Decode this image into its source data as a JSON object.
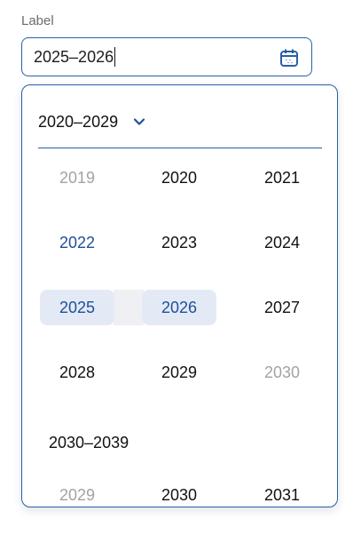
{
  "field": {
    "label": "Label",
    "value": "2025–2026",
    "calendar_icon": "calendar-icon"
  },
  "picker": {
    "header_label": "2020–2029",
    "header_icon": "chevron-down-icon",
    "years": [
      {
        "label": "2019",
        "state": "outside"
      },
      {
        "label": "2020",
        "state": "normal"
      },
      {
        "label": "2021",
        "state": "normal"
      },
      {
        "label": "2022",
        "state": "current"
      },
      {
        "label": "2023",
        "state": "normal"
      },
      {
        "label": "2024",
        "state": "normal"
      },
      {
        "label": "2025",
        "state": "range-start"
      },
      {
        "label": "2026",
        "state": "range-end"
      },
      {
        "label": "2027",
        "state": "normal"
      },
      {
        "label": "2028",
        "state": "normal"
      },
      {
        "label": "2029",
        "state": "normal"
      },
      {
        "label": "2030",
        "state": "outside"
      }
    ],
    "next_decade_label": "2030–2039",
    "next_years": [
      {
        "label": "2029",
        "state": "outside"
      },
      {
        "label": "2030",
        "state": "normal"
      },
      {
        "label": "2031",
        "state": "normal"
      }
    ]
  },
  "colors": {
    "accent": "#2a5ea8",
    "selected_bg": "#e3eaf5",
    "selected_text": "#1f4f9b",
    "muted_text": "#a3a3a3",
    "range_bg": "#eef0f3"
  }
}
